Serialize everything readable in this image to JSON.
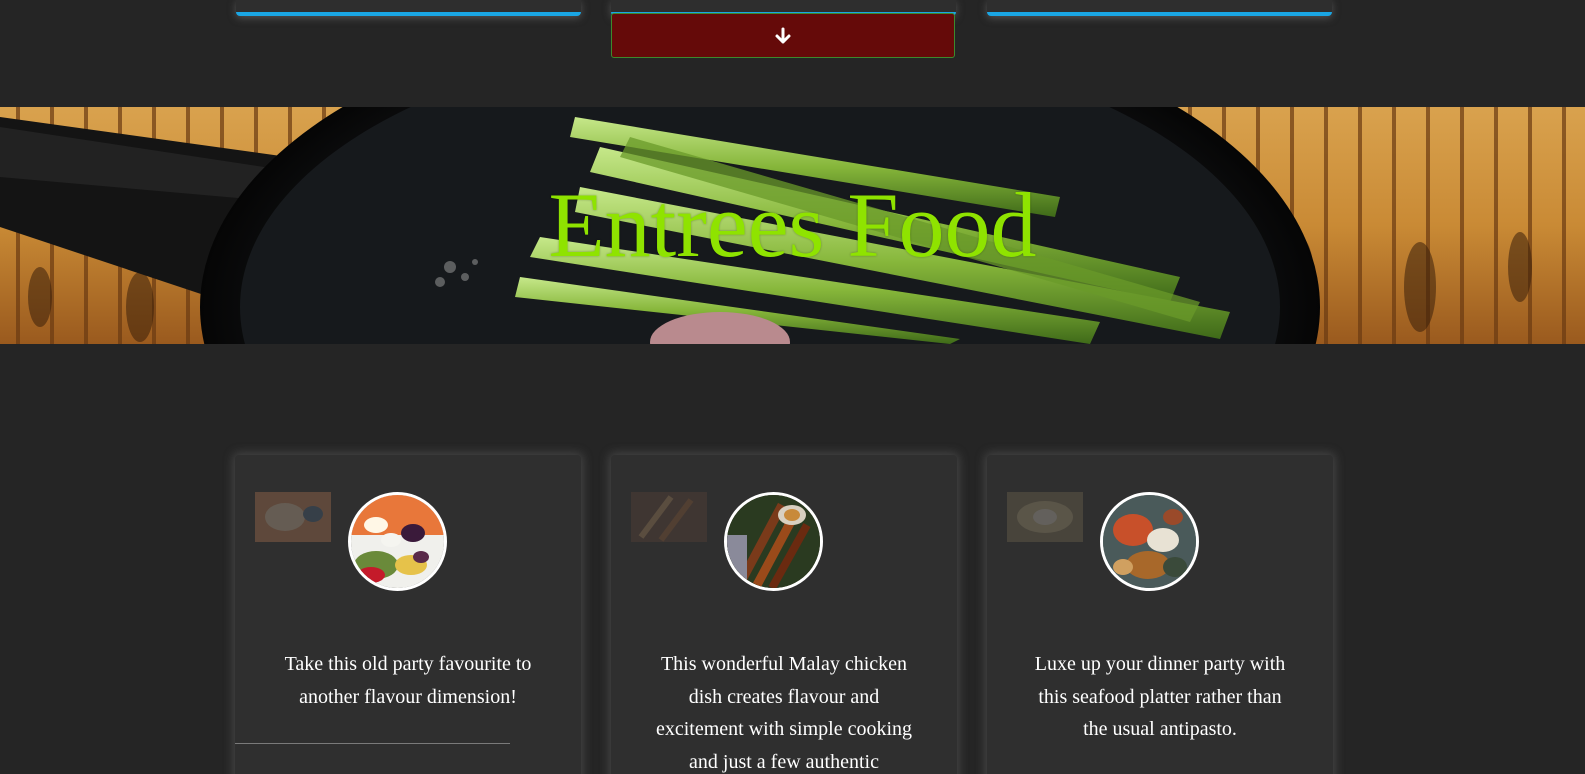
{
  "top_cards": {
    "accent_color": "#1aa6e4"
  },
  "expand_button": {
    "icon": "arrow-down-icon",
    "background_color": "#650a09"
  },
  "hero": {
    "title": "Entrees Food",
    "title_color": "#8fe300"
  },
  "cards": [
    {
      "description": "Take this old party favourite to another flavour dimension!"
    },
    {
      "description": "This wonderful Malay chicken dish creates flavour and excitement with simple cooking and just a few authentic ingredients."
    },
    {
      "description": "Luxe up your dinner party with this seafood platter rather than the usual antipasto."
    }
  ]
}
